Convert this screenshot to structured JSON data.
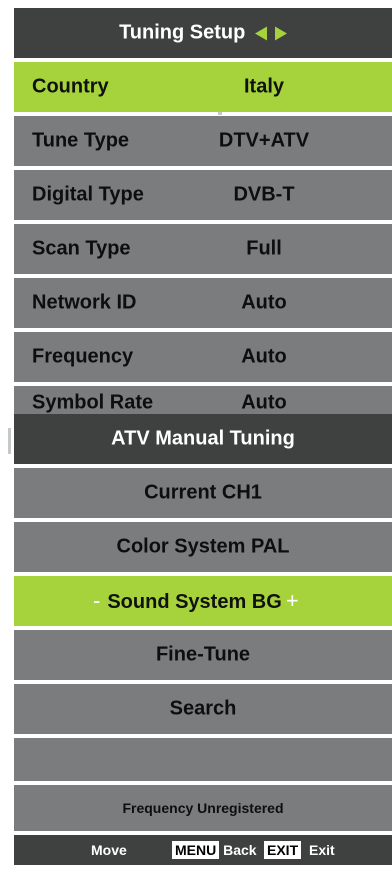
{
  "header": {
    "title": "Tuning Setup"
  },
  "settings": [
    {
      "label": "Country",
      "value": "Italy"
    },
    {
      "label": "Tune Type",
      "value": "DTV+ATV"
    },
    {
      "label": "Digital Type",
      "value": "DVB-T"
    },
    {
      "label": "Scan Type",
      "value": "Full"
    },
    {
      "label": "Network ID",
      "value": "Auto"
    },
    {
      "label": "Frequency",
      "value": "Auto"
    },
    {
      "label": "Symbol Rate",
      "value": "Auto"
    }
  ],
  "atv": {
    "title": "ATV Manual Tuning",
    "items": [
      "Current CH1",
      "Color System PAL",
      "Sound System BG",
      "Fine-Tune",
      "Search"
    ],
    "decrement_symbol": "-",
    "increment_symbol": "+"
  },
  "status": {
    "message": "Frequency Unregistered"
  },
  "footer": {
    "move_label": "Move",
    "menu_key": "MENU",
    "back_label": "Back",
    "exit_key": "EXIT",
    "exit_label": "Exit"
  },
  "colors": {
    "highlight": "#a6d33b",
    "row": "#7a7c7e",
    "header": "#3f4040"
  },
  "icons": {
    "header_arrows": "left-right-arrows-icon"
  }
}
